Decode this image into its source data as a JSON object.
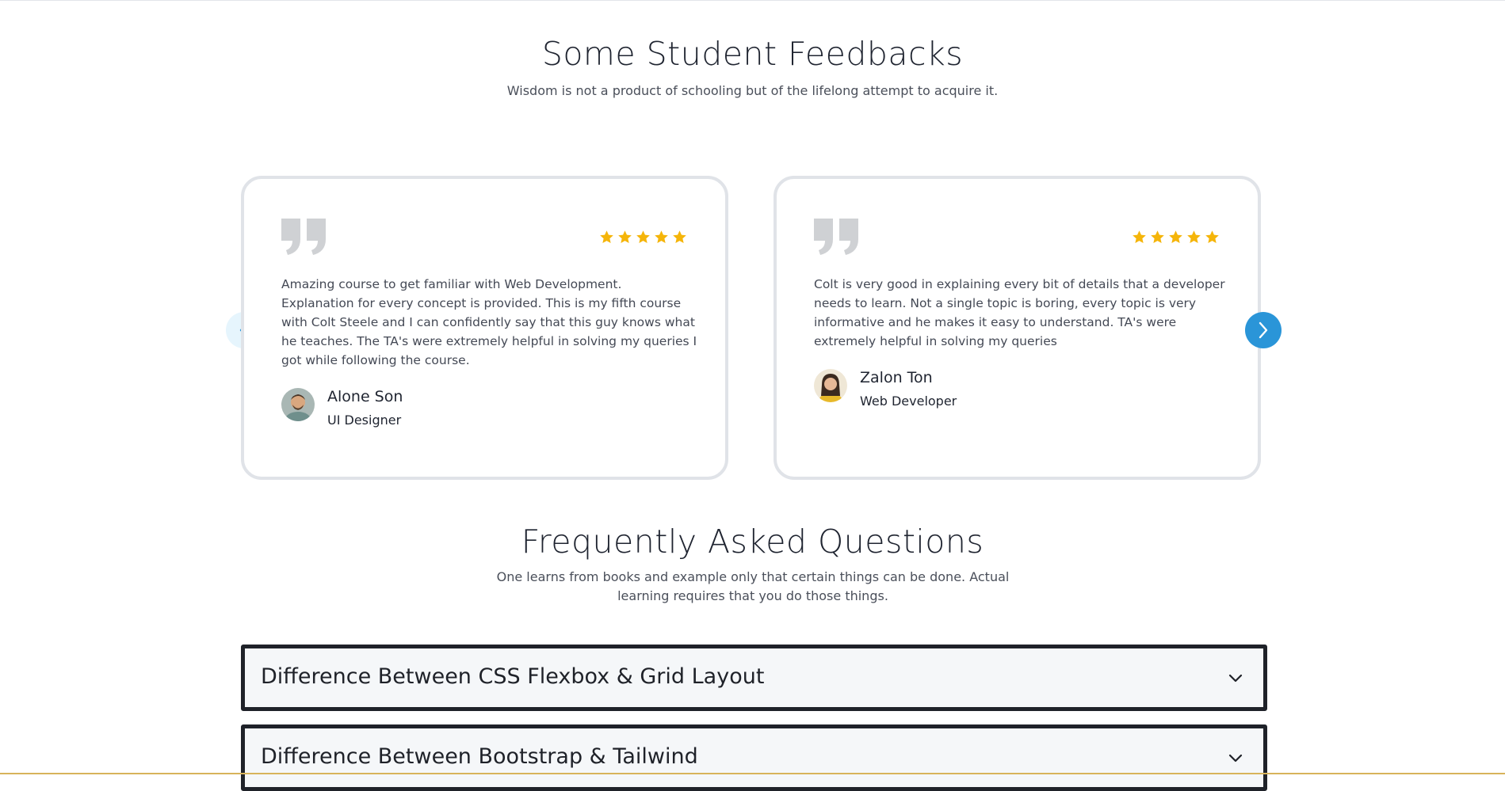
{
  "feedback": {
    "title": "Some Student Feedbacks",
    "subtitle": "Wisdom is not a product of schooling but of the lifelong attempt to acquire it.",
    "rating_color": "#f5b50a",
    "testimonials": [
      {
        "rating": 5,
        "text": "Amazing course to get familiar with Web Development. Explanation for every concept is provided. This is my fifth course with Colt Steele and I can confidently say that this guy knows what he teaches. The TA's were extremely helpful in solving my queries I got while following the course.",
        "name": "Alone Son",
        "role": "UI Designer"
      },
      {
        "rating": 5,
        "text": "Colt is very good in explaining every bit of details that a developer needs to learn. Not a single topic is boring, every topic is very informative and he makes it easy to understand. TA's were extremely helpful in solving my queries",
        "name": "Zalon Ton",
        "role": "Web Developer"
      }
    ],
    "nav": {
      "prev_icon": "chevron-left-icon",
      "next_icon": "chevron-right-icon",
      "accent": "#2a95d8"
    }
  },
  "faq": {
    "title": "Frequently Asked Questions",
    "subtitle": "One learns from books and example only that certain things can be done. Actual learning requires that you do those things.",
    "items": [
      {
        "question": "Difference Between CSS Flexbox & Grid Layout",
        "icon": "chevron-down-icon"
      },
      {
        "question": "Difference Between Bootstrap & Tailwind",
        "icon": "chevron-down-icon"
      }
    ]
  }
}
